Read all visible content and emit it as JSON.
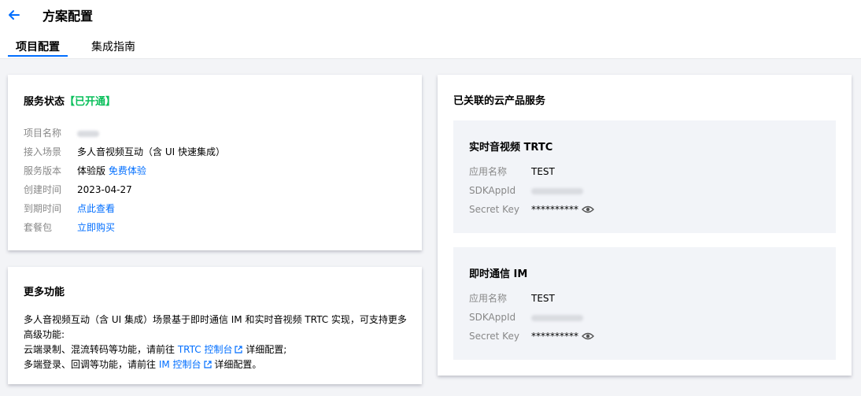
{
  "header": {
    "title": "方案配置",
    "tabs": [
      {
        "label": "项目配置",
        "active": true
      },
      {
        "label": "集成指南",
        "active": false
      }
    ]
  },
  "service_status": {
    "title": "服务状态",
    "status": "【已开通】",
    "rows": [
      {
        "label": "项目名称",
        "value": ""
      },
      {
        "label": "接入场景",
        "value": "多人音视频互动（含 UI 快速集成）"
      },
      {
        "label": "服务版本",
        "value": "体验版",
        "link": "免费体验"
      },
      {
        "label": "创建时间",
        "value": "2023-04-27"
      },
      {
        "label": "到期时间",
        "link": "点此查看"
      },
      {
        "label": "套餐包",
        "link": "立即购买"
      }
    ]
  },
  "more_features": {
    "title": "更多功能",
    "line1": "多人音视频互动（含 UI 集成）场景基于即时通信 IM 和实时音视频 TRTC 实现，可支持更多",
    "line2": "高级功能:",
    "line3_prefix": "云端录制、混流转码等功能，请前往",
    "line3_link": "TRTC 控制台",
    "line3_suffix": "详细配置;",
    "line4_prefix": "多端登录、回调等功能，请前往",
    "line4_link": "IM 控制台",
    "line4_suffix": "详细配置。"
  },
  "related_services": {
    "title": "已关联的云产品服务",
    "products": [
      {
        "title": "实时音视频 TRTC",
        "app_name_label": "应用名称",
        "app_name": "TEST",
        "sdkappid_label": "SDKAppId",
        "sdkappid": "",
        "secret_label": "Secret Key",
        "secret": "**********"
      },
      {
        "title": "即时通信 IM",
        "app_name_label": "应用名称",
        "app_name": "TEST",
        "sdkappid_label": "SDKAppId",
        "sdkappid": "",
        "secret_label": "Secret Key",
        "secret": "**********"
      }
    ]
  },
  "colors": {
    "accent": "#006eff",
    "success": "#0abf5b",
    "label": "#888888",
    "background": "#f3f4f7"
  },
  "icons": [
    "back-arrow-icon",
    "external-link-icon",
    "eye-icon"
  ]
}
